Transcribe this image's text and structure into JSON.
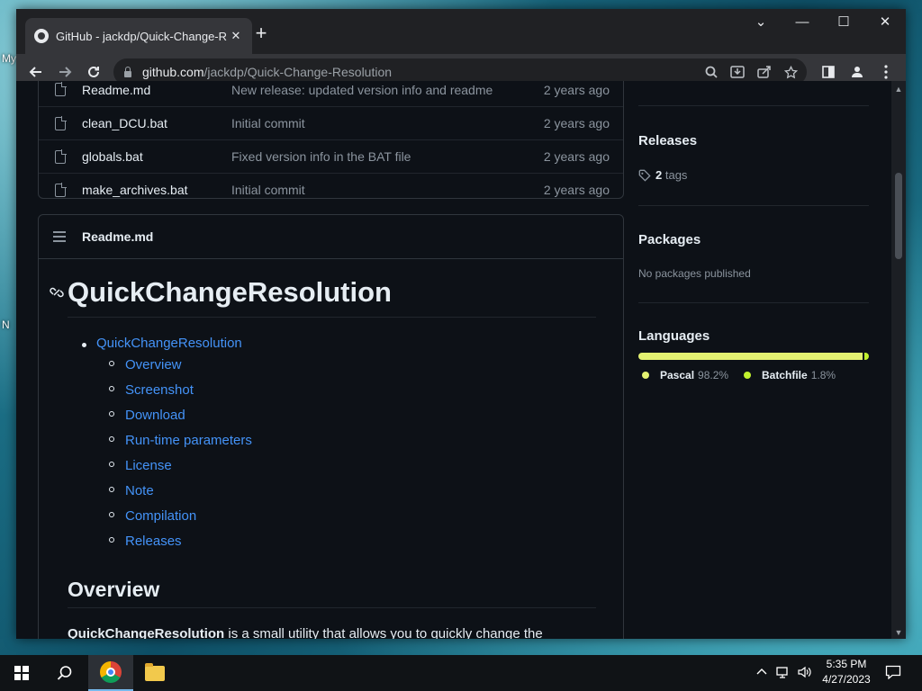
{
  "desktop": {
    "label_my": "My",
    "label_n": "N"
  },
  "browser": {
    "tab_title": "GitHub - jackdp/Quick-Change-R",
    "tab_close": "✕",
    "new_tab": "+",
    "url_host": "github.com",
    "url_path": "/jackdp/Quick-Change-Resolution",
    "controls": {
      "tab_search": "⌄",
      "minimize": "—",
      "maximize": "☐",
      "close": "✕"
    }
  },
  "files": [
    {
      "name": "Readme.md",
      "message": "New release: updated version info and readme",
      "age": "2 years ago"
    },
    {
      "name": "clean_DCU.bat",
      "message": "Initial commit",
      "age": "2 years ago"
    },
    {
      "name": "globals.bat",
      "message": "Fixed version info in the BAT file",
      "age": "2 years ago"
    },
    {
      "name": "make_archives.bat",
      "message": "Initial commit",
      "age": "2 years ago"
    }
  ],
  "readme": {
    "header": "Readme.md",
    "title": "QuickChangeResolution",
    "toc_top": "QuickChangeResolution",
    "toc": [
      "Overview",
      "Screenshot",
      "Download",
      "Run-time parameters",
      "License",
      "Note",
      "Compilation",
      "Releases"
    ],
    "h2": "Overview",
    "para_bold": "QuickChangeResolution",
    "para_rest": " is a small utility that allows you to quickly change the"
  },
  "sidebar": {
    "releases_heading": "Releases",
    "tags_count": "2",
    "tags_label": "tags",
    "packages_heading": "Packages",
    "packages_text": "No packages published",
    "languages_heading": "Languages",
    "languages": [
      {
        "name": "Pascal",
        "percent": "98.2%",
        "share": 98.2,
        "color": "#e3f171"
      },
      {
        "name": "Batchfile",
        "percent": "1.8%",
        "share": 1.8,
        "color": "#c1f12e"
      }
    ]
  },
  "taskbar": {
    "time": "5:35 PM",
    "date": "4/27/2023"
  }
}
